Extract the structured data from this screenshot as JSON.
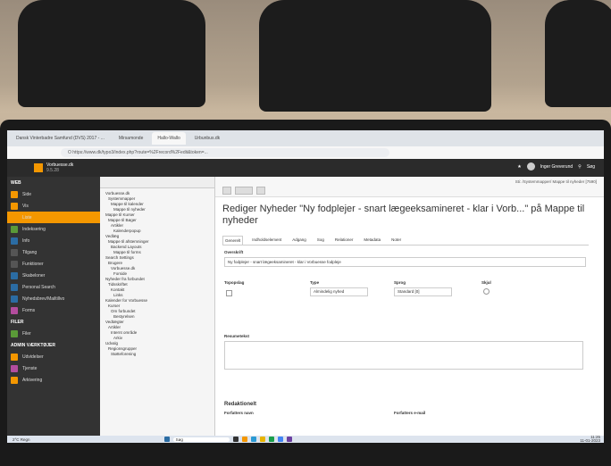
{
  "browser": {
    "tabs": [
      "Dansk Vinterbadre Samfund (DVS) 2017 - ...",
      "Mirsamonde",
      "Hallo-Wallo",
      "Urbunbus.dk"
    ],
    "url": "O  https://www.dk/typo3/index.php?route=%2Frecord%2Fedit&token=..."
  },
  "typo3": {
    "site_title": "Vorbuesse.dk",
    "site_subtitle": "9.5.28",
    "user": "Inger Greverund",
    "search_label": "Søg",
    "modules": [
      {
        "label": "WEB",
        "group": true
      },
      {
        "label": "Side",
        "color": "#f49700"
      },
      {
        "label": "Vis",
        "color": "#f49700"
      },
      {
        "label": "Liste",
        "color": "#f49700",
        "active": true
      },
      {
        "label": "Indeksering",
        "color": "#5a9a38"
      },
      {
        "label": "Info",
        "color": "#2b6ca3"
      },
      {
        "label": "Tilgang",
        "color": "#555"
      },
      {
        "label": "Funktioner",
        "color": "#555"
      },
      {
        "label": "Skabeloner",
        "color": "#2b6ca3"
      },
      {
        "label": "Personal Search",
        "color": "#2b6ca3"
      },
      {
        "label": "Nyhedsbrev/Mailtillvo",
        "color": "#2b6ca3"
      },
      {
        "label": "Forms",
        "color": "#b34d9e"
      },
      {
        "label": "FILER",
        "group": true
      },
      {
        "label": "Filer",
        "color": "#5a9a38"
      },
      {
        "label": "ADMIN VÆRKTØJER",
        "group": true
      },
      {
        "label": "Udvidelser",
        "color": "#f49700"
      },
      {
        "label": "Tjenste",
        "color": "#b34d9e"
      },
      {
        "label": "Arkivering",
        "color": "#f49700"
      }
    ],
    "tree": [
      "Vorbuesse.dk",
      "Systemmapper",
      "Mappe til kalender",
      "Mappe til nyheder",
      "Mappe til Kurser",
      "Mappe til Bøger",
      "Artikler",
      "Kalenderpopup",
      "Vedlæg",
      "Mappe til afstemninger",
      "Backend Layouts",
      "Mappe til forms",
      "Search Settings",
      "Brugere",
      "Vorbuesse.dk",
      "Forside",
      "Nyheder fra forbundet",
      "Tidsskriftet",
      "Kontakt",
      "Links",
      "Kalender for Vorbuesse",
      "Kurser",
      "Om forbundet",
      "Bestyrelsen",
      "Vedtægter",
      "Artikler",
      "Internt område",
      "Arkiv",
      "Udvalg",
      "Regionsgrupper",
      "Støtteforening"
    ],
    "heading": "Rediger Nyheder \"Ny fodplejer - snart lægeeksamineret - klar i Vorb...\" på Mappe til nyheder",
    "breadcrumb": "Sti: /Systemmapper/ Mappe til nyheder [7590]",
    "tabs": [
      "Generelt",
      "Indholdselement",
      "Adgang",
      "Sog",
      "Relationer",
      "Metadata",
      "Noter"
    ],
    "field_overskrift_label": "Overskrift",
    "field_overskrift_value": "Ny fodplejer - snart lægeeksamineret - klar i Vorbuesse fodpleje",
    "toppost_label": "Topopslag",
    "type_label": "Type",
    "type_value": "Almindelig nyhed",
    "sprog_label": "Sprog",
    "sprog_value": "Standard [0]",
    "skjul_label": "Skjul",
    "resume_label": "Resumetekst",
    "redaktion_label": "Redaktionelt",
    "forfatter_label": "Forfatters navn",
    "forfatter_email_label": "Forfatters e-mail"
  },
  "taskbar": {
    "weather": "2°C Regn",
    "search": "Søg",
    "time": "11:25",
    "date": "11-01-2023"
  }
}
